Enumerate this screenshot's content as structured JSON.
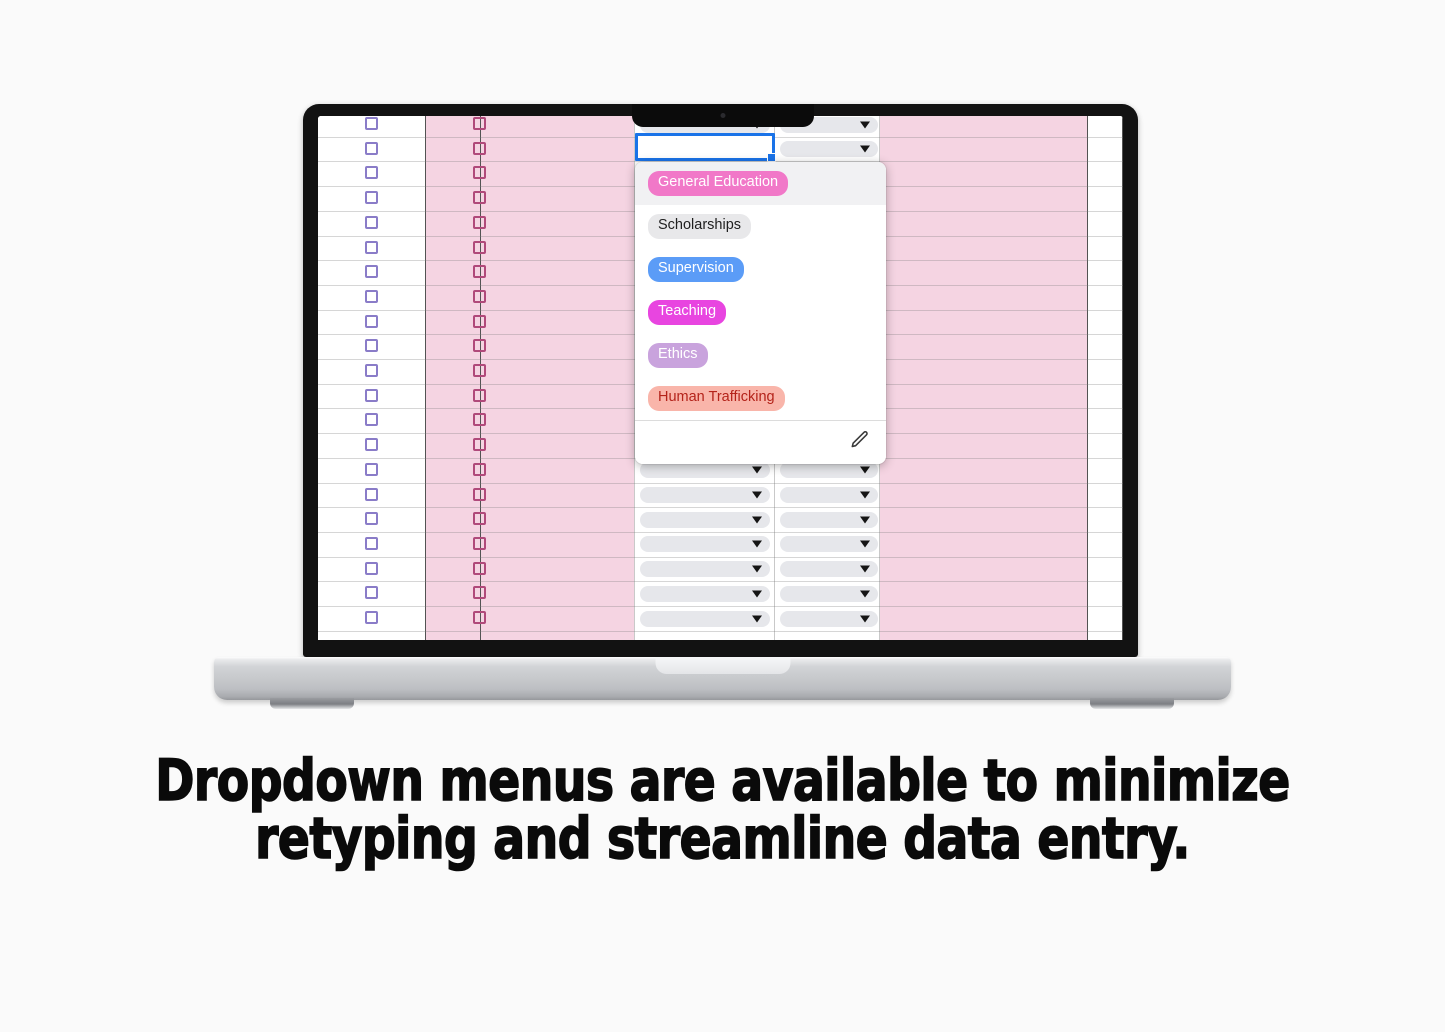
{
  "caption": {
    "line1": "Dropdown menus are available to minimize",
    "line2": "retyping and streamline data entry."
  },
  "device": {
    "type": "laptop-mockup",
    "camera_icon": "camera-lens-icon"
  },
  "spreadsheet": {
    "active_cell": {
      "value": "",
      "placeholder": ""
    },
    "columns": [
      {
        "name": "checkbox-col-1",
        "fill": "#ffffff",
        "checkbox_color": "#8a7cc8"
      },
      {
        "name": "checkbox-col-2",
        "fill": "#f5d4e2",
        "checkbox_color": "#b0497a"
      },
      {
        "name": "text-col-1",
        "fill": "#f5d4e2"
      },
      {
        "name": "dropdown-col-1",
        "fill": "#ffffff"
      },
      {
        "name": "dropdown-col-2",
        "fill": "#ffffff"
      },
      {
        "name": "text-col-2",
        "fill": "#f5d4e2"
      },
      {
        "name": "text-col-3",
        "fill": "#ffffff"
      }
    ],
    "row_count": 21,
    "dropdown_cell_icon": "chevron-down-icon"
  },
  "dropdown": {
    "highlighted_index": 0,
    "edit_icon": "pencil-icon",
    "options": [
      {
        "label": "General Education",
        "bg": "#f178c8",
        "fg": "#ffffff"
      },
      {
        "label": "Scholarships",
        "bg": "#e8e8ea",
        "fg": "#1f1f1f"
      },
      {
        "label": "Supervision",
        "bg": "#5b9cf7",
        "fg": "#ffffff"
      },
      {
        "label": "Teaching",
        "bg": "#e845e0",
        "fg": "#ffffff"
      },
      {
        "label": "Ethics",
        "bg": "#c9a3dd",
        "fg": "#ffffff"
      },
      {
        "label": "Human Trafficking",
        "bg": "#f9b5aa",
        "fg": "#b4231a"
      }
    ]
  },
  "colors": {
    "pink_column": "#f5d4e2",
    "accent_selection": "#1a73e8",
    "bezel": "#121212",
    "page_background": "#fafafa"
  }
}
